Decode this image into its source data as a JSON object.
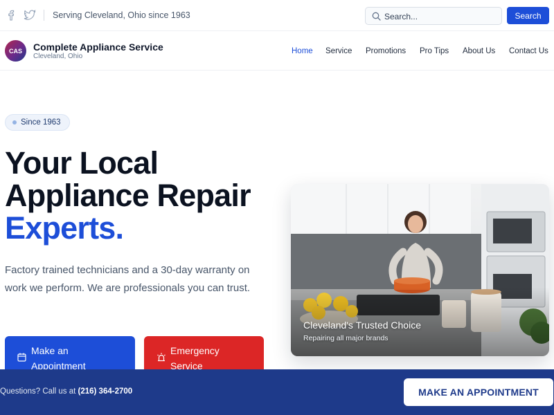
{
  "topbar": {
    "social_icons": [
      "facebook-icon",
      "twitter-icon"
    ],
    "tagline": "Serving Cleveland, Ohio since 1963",
    "search": {
      "placeholder": "Search...",
      "value": ""
    },
    "search_button": "Search"
  },
  "header": {
    "logo_text": "CAS",
    "brand_name": "Complete Appliance Service",
    "brand_location": "Cleveland, Ohio",
    "nav": [
      {
        "label": "Home",
        "active": true
      },
      {
        "label": "Service",
        "active": false
      },
      {
        "label": "Promotions",
        "active": false
      },
      {
        "label": "Pro Tips",
        "active": false
      },
      {
        "label": "About Us",
        "active": false
      },
      {
        "label": "Contact Us",
        "active": false
      }
    ]
  },
  "hero": {
    "badge": "Since 1963",
    "headline_line1": "Your Local",
    "headline_line2": "Appliance Repair",
    "headline_accent": "Experts.",
    "lead": "Factory trained technicians and a 30-day warranty on work we perform. We are professionals you can trust.",
    "cta_primary": {
      "label": "Make an Appointment",
      "icon": "calendar-icon"
    },
    "cta_secondary": {
      "label": "Emergency Service",
      "icon": "siren-icon"
    },
    "image_card": {
      "title": "Cleveland's Trusted Choice",
      "subtitle": "Repairing all major brands"
    }
  },
  "bottom_bar": {
    "questions_prefix": "Questions? Call us at",
    "phone": "(216) 364-2700",
    "button": "MAKE AN APPOINTMENT"
  },
  "colors": {
    "primary": "#1d4ed8",
    "emergency": "#dc2626",
    "bottom_bar": "#1e3a8a",
    "heading": "#0b1220"
  }
}
